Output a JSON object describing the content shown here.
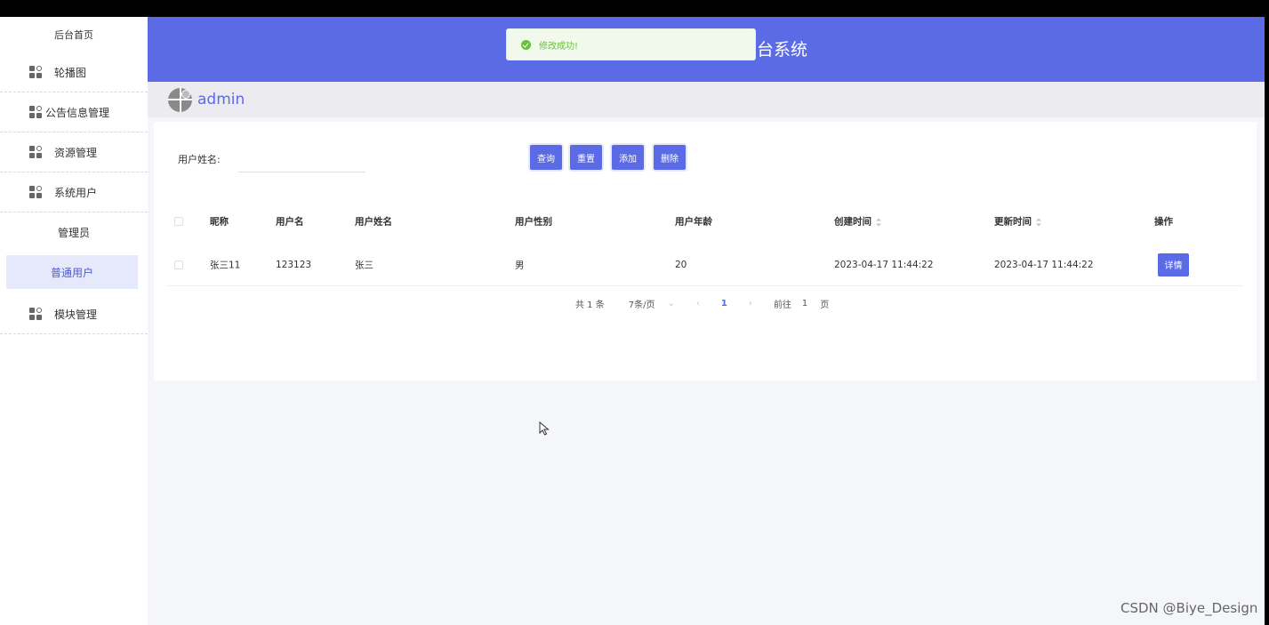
{
  "sidebar": {
    "home_label": "后台首页",
    "items": [
      {
        "label": "轮播图",
        "icon": "grid-icon"
      },
      {
        "label": "公告信息管理",
        "icon": "grid-icon"
      },
      {
        "label": "资源管理",
        "icon": "grid-icon"
      },
      {
        "label": "系统用户",
        "icon": "grid-icon"
      }
    ],
    "sub_items": [
      {
        "label": "管理员",
        "active": false
      },
      {
        "label": "普通用户",
        "active": true
      }
    ],
    "last_item": {
      "label": "模块管理",
      "icon": "grid-icon"
    }
  },
  "header": {
    "title_fragment": "台系统",
    "background": "#5b6be6"
  },
  "toast": {
    "message": "修改成功!",
    "type": "success"
  },
  "userbar": {
    "username": "admin"
  },
  "search": {
    "label": "用户姓名:",
    "value": "",
    "placeholder": ""
  },
  "toolbar": {
    "query_label": "查询",
    "reset_label": "重置",
    "add_label": "添加",
    "delete_label": "删除"
  },
  "table": {
    "columns": [
      "昵称",
      "用户名",
      "用户姓名",
      "用户性别",
      "用户年龄",
      "创建时间",
      "更新时间",
      "操作"
    ],
    "rows": [
      {
        "nickname": "张三11",
        "username": "123123",
        "realname": "张三",
        "gender": "男",
        "age": "20",
        "created": "2023-04-17 11:44:22",
        "updated": "2023-04-17 11:44:22",
        "action_label": "详情"
      }
    ]
  },
  "pagination": {
    "total_text": "共 1 条",
    "page_size_text": "7条/页",
    "current_page": "1",
    "goto_prefix": "前往",
    "goto_value": "1",
    "goto_suffix": "页"
  },
  "watermark": "CSDN @Biye_Design"
}
